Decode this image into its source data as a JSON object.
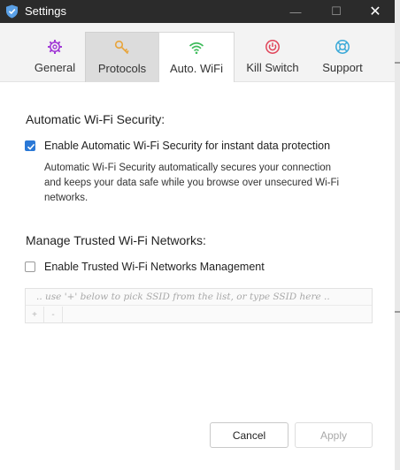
{
  "window": {
    "title": "Settings",
    "controls": {
      "minimize": "—",
      "maximize": "☐",
      "close": "✕"
    }
  },
  "tabs": [
    {
      "label": "General",
      "icon": "gear-icon",
      "color": "#a23bd6",
      "state": "inactive"
    },
    {
      "label": "Protocols",
      "icon": "key-icon",
      "color": "#e8a43a",
      "state": "hover"
    },
    {
      "label": "Auto. WiFi",
      "icon": "wifi-icon",
      "color": "#3dbb5a",
      "state": "active"
    },
    {
      "label": "Kill Switch",
      "icon": "power-icon",
      "color": "#e0455a",
      "state": "inactive"
    },
    {
      "label": "Support",
      "icon": "lifebuoy-icon",
      "color": "#3aa9d8",
      "state": "inactive"
    }
  ],
  "auto_wifi": {
    "section_title": "Automatic Wi-Fi Security:",
    "enable_label": "Enable Automatic Wi-Fi Security for instant data protection",
    "enable_checked": true,
    "description": "Automatic Wi-Fi Security automatically secures your connection and keeps your data safe while you browse over unsecured Wi-Fi networks."
  },
  "trusted": {
    "section_title": "Manage Trusted Wi-Fi Networks:",
    "enable_label": "Enable Trusted Wi-Fi Networks Management",
    "enable_checked": false,
    "ssid_placeholder": ".. use '+' below to pick SSID from the list, or type SSID here ..",
    "add_label": "+",
    "remove_label": "-"
  },
  "buttons": {
    "cancel": "Cancel",
    "apply": "Apply"
  },
  "colors": {
    "titlebar": "#2b2b2b",
    "accent": "#2a78d6"
  }
}
